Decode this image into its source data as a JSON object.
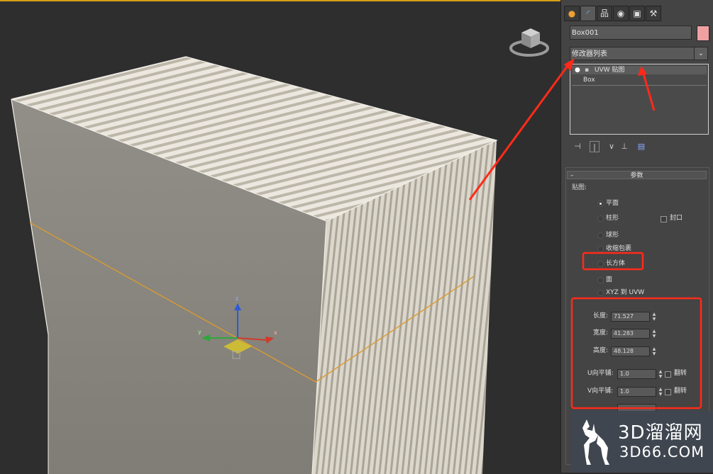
{
  "command_panel": {
    "tabs": [
      {
        "icon": "create-tab-icon",
        "glyph": "●"
      },
      {
        "icon": "modify-tab-icon",
        "glyph": "◜"
      },
      {
        "icon": "hierarchy-tab-icon",
        "glyph": "品"
      },
      {
        "icon": "motion-tab-icon",
        "glyph": "◉"
      },
      {
        "icon": "display-tab-icon",
        "glyph": "▣"
      },
      {
        "icon": "utilities-tab-icon",
        "glyph": "⚒"
      }
    ],
    "object_name": "Box001",
    "object_color": "#f0a0a0",
    "modifier_list_label": "修改器列表",
    "stack": [
      "UVW 贴图",
      "Box"
    ],
    "params": {
      "title": "参数",
      "mapping_label": "贴图:",
      "options": [
        {
          "label": "平面",
          "selected": true
        },
        {
          "label": "柱形",
          "selected": false
        },
        {
          "label": "球形",
          "selected": false
        },
        {
          "label": "收缩包裹",
          "selected": false
        },
        {
          "label": "长方体",
          "selected": false
        },
        {
          "label": "面",
          "selected": false
        },
        {
          "label": "XYZ 到 UVW",
          "selected": false
        }
      ],
      "cap_label": "封口",
      "length_label": "长度:",
      "length_value": "71.527",
      "width_label": "宽度:",
      "width_value": "41.283",
      "height_label": "高度:",
      "height_value": "48.128",
      "u_tile_label": "U向平铺:",
      "u_tile_value": "1.0",
      "v_tile_label": "V向平铺:",
      "v_tile_value": "1.0",
      "flip_label": "翻转"
    }
  },
  "viewport": {
    "gizmo_axes": [
      "x",
      "y",
      "z"
    ],
    "colors": {
      "box_front": "#8c8a82",
      "box_top_light": "#ece8df",
      "box_top_dark": "#b9b3a6",
      "selection_line": "#d99a32",
      "highlight": "#ff2a1a"
    }
  },
  "watermark": {
    "line1": "3D溜溜网",
    "line2": "3D66.COM"
  }
}
